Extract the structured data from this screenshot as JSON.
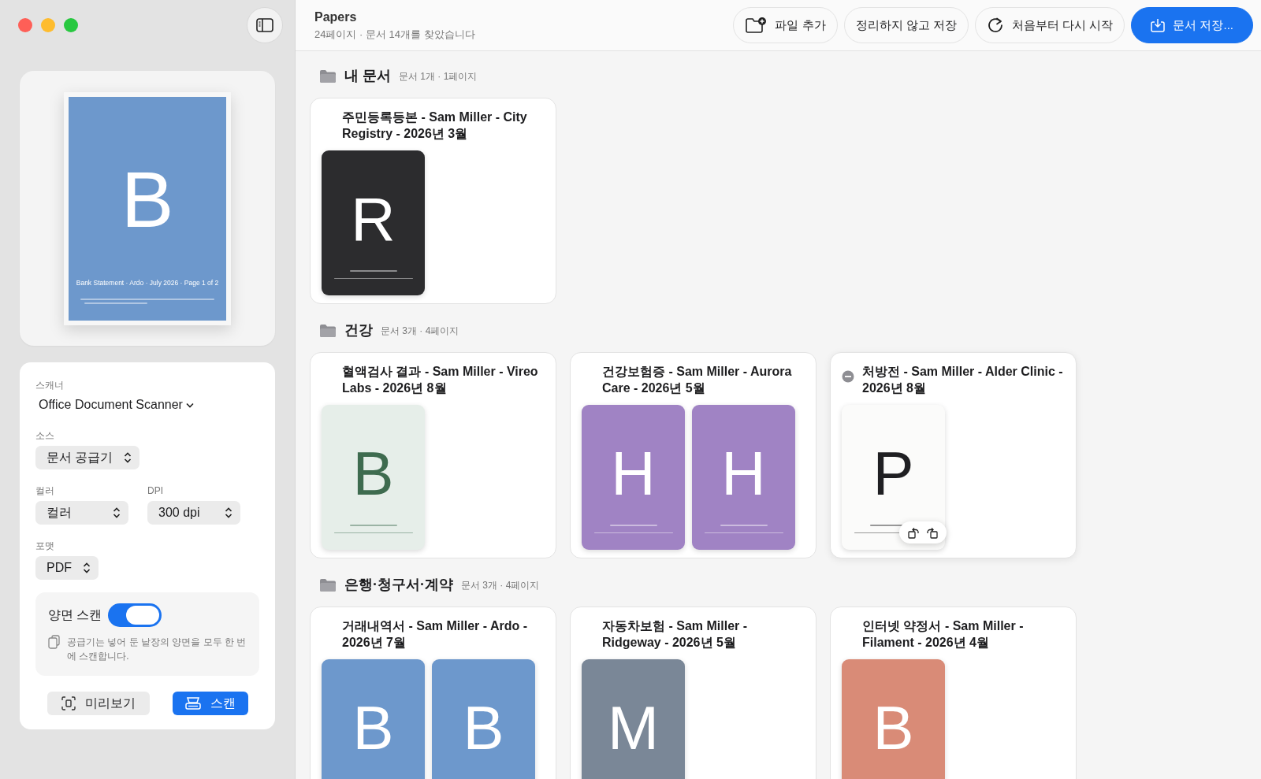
{
  "toolbar": {
    "title": "Papers",
    "subtitle": "24페이지 · 문서 14개를 찾았습니다",
    "buttons": [
      {
        "label": "파일 추가",
        "kind": "add-file"
      },
      {
        "label": "정리하지 않고 저장",
        "kind": "plain"
      },
      {
        "label": "처음부터 다시 시작",
        "kind": "restart"
      },
      {
        "label": "문서 저장...",
        "kind": "primary"
      }
    ]
  },
  "sidebar": {
    "preview": {
      "letter": {
        "text": "B",
        "color": "#ffffff"
      },
      "color": "#6d98cc",
      "caption": "Bank Statement · Ardo · July 2026 · Page 1 of 2"
    },
    "scanner": {
      "label": "스캐너",
      "value": "Office Document Scanner"
    },
    "field_rows": [
      [
        {
          "label": "소스",
          "value": "문서 공급기"
        }
      ],
      [
        {
          "label": "컬러",
          "value": "컬러"
        },
        {
          "label": "DPI",
          "value": "300 dpi"
        }
      ],
      [
        {
          "label": "포맷",
          "value": "PDF"
        }
      ]
    ],
    "duplex": {
      "label": "양면 스캔",
      "on": true,
      "note": "공급기는 넣어 둔 낱장의 양면을 모두 한 번에 스캔합니다."
    },
    "buttons": [
      {
        "label": "미리보기",
        "kind": "preview"
      },
      {
        "label": "스캔",
        "kind": "scan"
      }
    ]
  },
  "groups": [
    {
      "name": "내 문서",
      "summary": "문서 1개 · 1페이지",
      "documents": [
        {
          "title": "주민등록등본 - Sam Miller - City Registry - 2026년 3월",
          "hovered": false,
          "pages": [
            {
              "letter": {
                "text": "R",
                "color": "#ffffff"
              },
              "color": "#2c2c2e"
            }
          ]
        }
      ]
    },
    {
      "name": "건강",
      "summary": "문서 3개 · 4페이지",
      "documents": [
        {
          "title": "혈액검사 결과 - Sam Miller - Vireo Labs - 2026년 8월",
          "hovered": false,
          "pages": [
            {
              "letter": {
                "text": "B",
                "color": "#3e6b4f"
              },
              "color": "#e6eee9"
            }
          ]
        },
        {
          "title": "건강보험증 - Sam Miller - Aurora Care - 2026년 5월",
          "hovered": false,
          "pages": [
            {
              "letter": {
                "text": "H",
                "color": "#ffffff"
              },
              "color": "#a083c4"
            },
            {
              "letter": {
                "text": "H",
                "color": "#ffffff"
              },
              "color": "#a083c4"
            }
          ]
        },
        {
          "title": "처방전 - Sam Miller - Alder Clinic - 2026년 8월",
          "hovered": true,
          "pages": [
            {
              "letter": {
                "text": "P",
                "color": "#1f1f22"
              },
              "color": "#fbfbfa"
            }
          ]
        }
      ]
    },
    {
      "name": "은행·청구서·계약",
      "summary": "문서 3개 · 4페이지",
      "documents": [
        {
          "title": "거래내역서 - Sam Miller - Ardo - 2026년 7월",
          "hovered": false,
          "pages": [
            {
              "letter": {
                "text": "B",
                "color": "#ffffff"
              },
              "color": "#6d98cc"
            },
            {
              "letter": {
                "text": "B",
                "color": "#ffffff"
              },
              "color": "#6d98cc"
            }
          ]
        },
        {
          "title": "자동차보험 - Sam Miller - Ridgeway - 2026년 5월",
          "hovered": false,
          "pages": [
            {
              "letter": {
                "text": "M",
                "color": "#ffffff"
              },
              "color": "#7a8797"
            }
          ]
        },
        {
          "title": "인터넷 약정서 - Sam Miller - Filament - 2026년 4월",
          "hovered": false,
          "pages": [
            {
              "letter": {
                "text": "B",
                "color": "#ffffff"
              },
              "color": "#d98b77"
            }
          ]
        }
      ]
    }
  ]
}
